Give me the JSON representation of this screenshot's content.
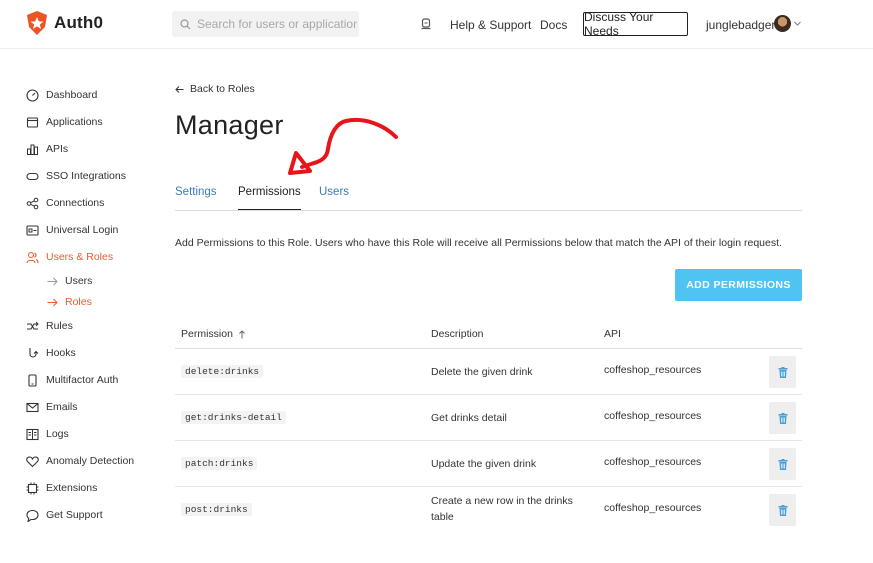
{
  "header": {
    "brand": "Auth0",
    "search_placeholder": "Search for users or applications",
    "help_label": "Help & Support",
    "docs_label": "Docs",
    "discuss_label": "Discuss Your Needs",
    "username": "junglebadger"
  },
  "sidebar": {
    "items": [
      {
        "label": "Dashboard",
        "icon": "dashboard-icon"
      },
      {
        "label": "Applications",
        "icon": "applications-icon"
      },
      {
        "label": "APIs",
        "icon": "apis-icon"
      },
      {
        "label": "SSO Integrations",
        "icon": "sso-icon"
      },
      {
        "label": "Connections",
        "icon": "connections-icon"
      },
      {
        "label": "Universal Login",
        "icon": "universal-login-icon"
      },
      {
        "label": "Users & Roles",
        "icon": "users-icon"
      },
      {
        "label": "Rules",
        "icon": "rules-icon"
      },
      {
        "label": "Hooks",
        "icon": "hooks-icon"
      },
      {
        "label": "Multifactor Auth",
        "icon": "mfa-icon"
      },
      {
        "label": "Emails",
        "icon": "email-icon"
      },
      {
        "label": "Logs",
        "icon": "logs-icon"
      },
      {
        "label": "Anomaly Detection",
        "icon": "heart-icon"
      },
      {
        "label": "Extensions",
        "icon": "extensions-icon"
      },
      {
        "label": "Get Support",
        "icon": "support-icon"
      }
    ],
    "subitems": [
      {
        "label": "Users"
      },
      {
        "label": "Roles"
      }
    ],
    "accent_color": "#e75c32"
  },
  "main": {
    "back_label": "Back to Roles",
    "title": "Manager",
    "tabs": [
      {
        "label": "Settings"
      },
      {
        "label": "Permissions"
      },
      {
        "label": "Users"
      }
    ],
    "active_tab": "Permissions",
    "description": "Add Permissions to this Role. Users who have this Role will receive all Permissions below that match the API of their login request.",
    "add_button_label": "ADD PERMISSIONS",
    "add_button_color": "#4fc3f1",
    "table": {
      "headers": [
        "Permission",
        "Description",
        "API"
      ],
      "rows": [
        {
          "permission": "delete:drinks",
          "description": "Delete the given drink",
          "api": "coffeshop_resources"
        },
        {
          "permission": "get:drinks-detail",
          "description": "Get drinks detail",
          "api": "coffeshop_resources"
        },
        {
          "permission": "patch:drinks",
          "description": "Update the given drink",
          "api": "coffeshop_resources"
        },
        {
          "permission": "post:drinks",
          "description": "Create a new row in the drinks table",
          "api": "coffeshop_resources"
        }
      ]
    }
  }
}
